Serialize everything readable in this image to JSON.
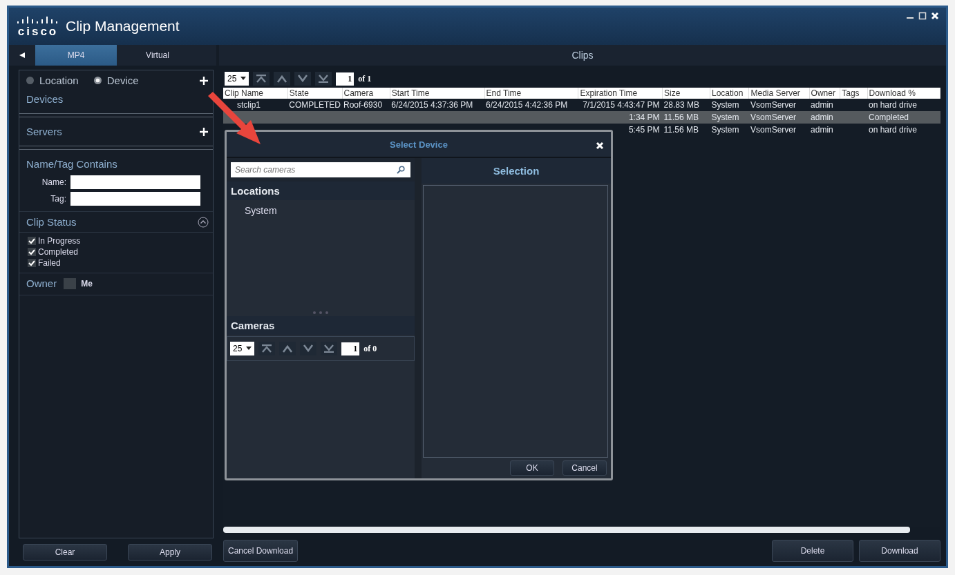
{
  "window": {
    "logo": "cisco",
    "title": "Clip Management"
  },
  "tabs": [
    {
      "label": "MP4",
      "selected": true
    },
    {
      "label": "Virtual",
      "selected": false
    }
  ],
  "clips_title": "Clips",
  "filter": {
    "modes": [
      {
        "label": "Location",
        "selected": false
      },
      {
        "label": "Device",
        "selected": true
      }
    ],
    "sections": [
      "Devices",
      "Servers"
    ],
    "name_tag": {
      "title": "Name/Tag Contains",
      "fields": [
        {
          "label": "Name:"
        },
        {
          "label": "Tag:"
        }
      ]
    },
    "clip_status": {
      "title": "Clip Status",
      "items": [
        {
          "label": "In Progress",
          "checked": true
        },
        {
          "label": "Completed",
          "checked": true
        },
        {
          "label": "Failed",
          "checked": true
        }
      ]
    },
    "owner": {
      "label": "Owner",
      "option": "Me",
      "checked": false
    },
    "buttons": [
      "Clear",
      "Apply"
    ]
  },
  "pager": {
    "page_size": "25",
    "page": "1",
    "of": "of 1"
  },
  "table": {
    "columns": [
      "Clip Name",
      "State",
      "Camera",
      "Start Time",
      "End Time",
      "Expiration Time",
      "Size",
      "Location",
      "Media Server",
      "Owner",
      "Tags",
      "Download %"
    ],
    "rows": [
      {
        "selected": false,
        "cells": [
          "stclip1",
          "COMPLETED",
          "Roof-6930",
          "6/24/2015 4:37:36 PM",
          "6/24/2015 4:42:36 PM",
          "7/1/2015 4:43:47 PM",
          "28.83 MB",
          "System",
          "VsomServer",
          "admin",
          null,
          "on hard drive"
        ]
      },
      {
        "selected": true,
        "cells": [
          null,
          null,
          null,
          null,
          null,
          "1:34 PM",
          "11.56 MB",
          "System",
          "VsomServer",
          "admin",
          null,
          "Completed"
        ]
      },
      {
        "selected": false,
        "cells": [
          null,
          null,
          null,
          null,
          null,
          "5:45 PM",
          "11.56 MB",
          "System",
          "VsomServer",
          "admin",
          null,
          "on hard drive"
        ]
      }
    ]
  },
  "actions": {
    "left": [
      "Cancel Download"
    ],
    "right": [
      "Delete",
      "Download"
    ]
  },
  "dialog": {
    "title": "Select Device",
    "search": {
      "placeholder": "Search cameras"
    },
    "locations_title": "Locations",
    "locations": [
      "System"
    ],
    "cameras_title": "Cameras",
    "pager": {
      "page_size": "25",
      "page": "1",
      "of": "of 0"
    },
    "selection_title": "Selection",
    "buttons": [
      "OK",
      "Cancel"
    ]
  }
}
